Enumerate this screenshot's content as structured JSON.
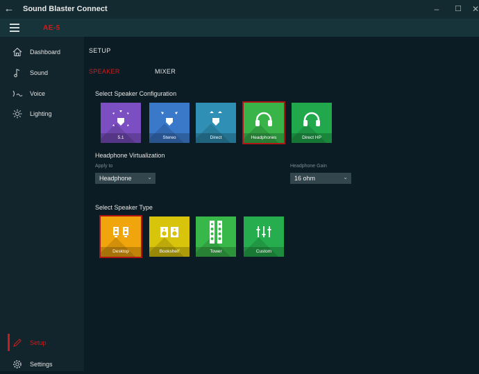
{
  "app": {
    "title": "Sound Blaster Connect",
    "device": "AE-5"
  },
  "window": {
    "minimize": "–",
    "maximize": "☐",
    "close": "✕"
  },
  "sidebar": {
    "items": [
      {
        "label": "Dashboard",
        "icon": "home-icon"
      },
      {
        "label": "Sound",
        "icon": "music-note-icon"
      },
      {
        "label": "Voice",
        "icon": "voice-icon"
      },
      {
        "label": "Lighting",
        "icon": "light-icon"
      },
      {
        "label": "Setup",
        "icon": "pencil-icon"
      },
      {
        "label": "Settings",
        "icon": "gear-icon"
      }
    ],
    "active": "Setup"
  },
  "main": {
    "title": "SETUP",
    "tabs": [
      {
        "label": "SPEAKER",
        "active": true
      },
      {
        "label": "MIXER",
        "active": false
      }
    ],
    "speaker_config": {
      "title": "Select Speaker Configuration",
      "options": [
        {
          "label": "5.1",
          "color": "#7b4fc1",
          "selected": false
        },
        {
          "label": "Stereo",
          "color": "#3a78c9",
          "selected": false
        },
        {
          "label": "Direct",
          "color": "#2f8fb4",
          "selected": false
        },
        {
          "label": "Headphones",
          "color": "#38b449",
          "selected": true
        },
        {
          "label": "Direct HP",
          "color": "#21a84c",
          "selected": false
        }
      ]
    },
    "headphone_virtualization": {
      "title": "Headphone Virtualization",
      "apply_to_label": "Apply to",
      "apply_to_value": "Headphone",
      "gain_label": "Headphone Gain",
      "gain_value": "16 ohm"
    },
    "speaker_type": {
      "title": "Select Speaker Type",
      "options": [
        {
          "label": "Desktop",
          "color": "#f0a50c",
          "selected": true
        },
        {
          "label": "Bookshelf",
          "color": "#d9c40c",
          "selected": false
        },
        {
          "label": "Tower",
          "color": "#39b84a",
          "selected": false
        },
        {
          "label": "Custom",
          "color": "#26ae4e",
          "selected": false
        }
      ]
    }
  }
}
